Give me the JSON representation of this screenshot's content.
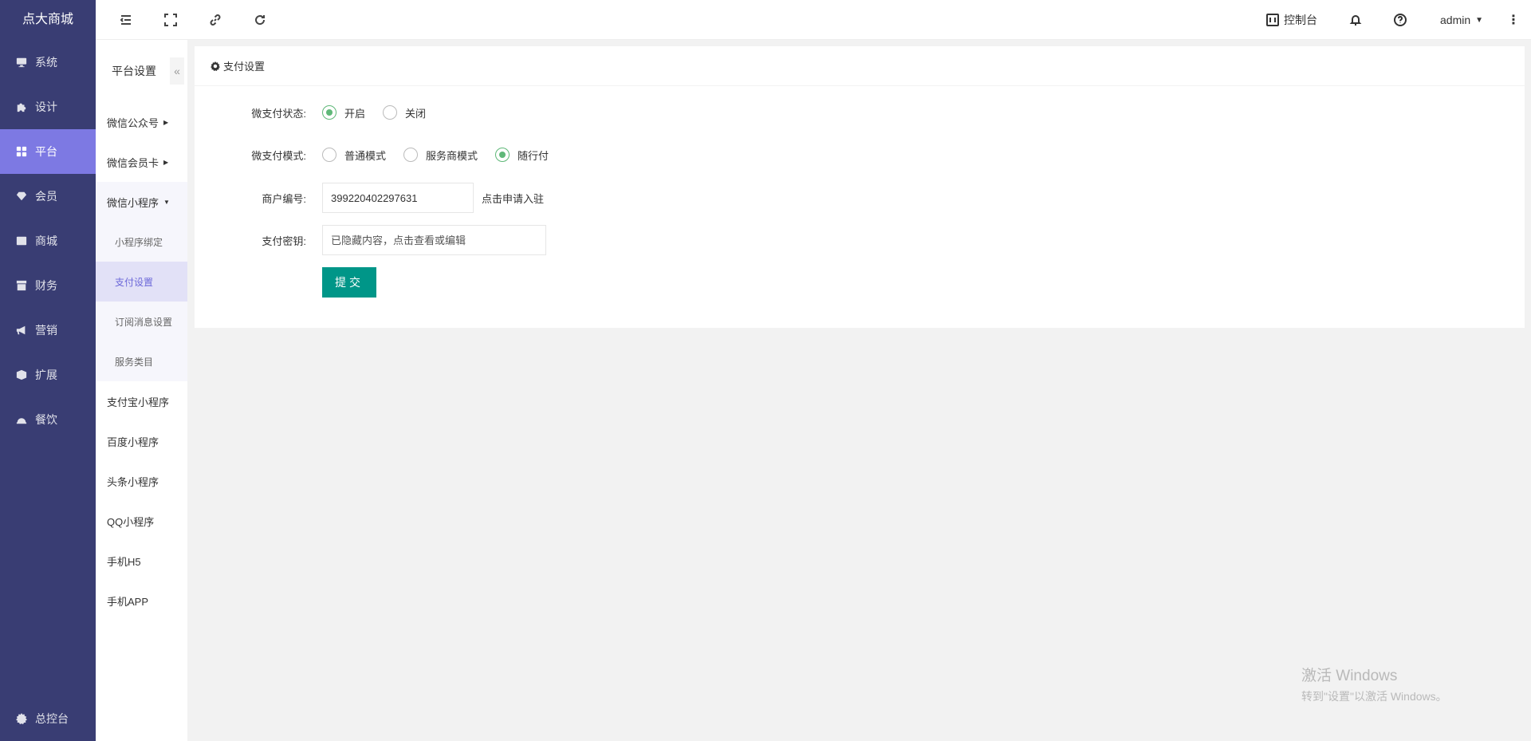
{
  "app": {
    "logo_text": "点大商城"
  },
  "sidebar": {
    "items": [
      {
        "label": "系统",
        "icon": "monitor-icon"
      },
      {
        "label": "设计",
        "icon": "puzzle-icon"
      },
      {
        "label": "平台",
        "icon": "grid-icon",
        "active": true
      },
      {
        "label": "会员",
        "icon": "diamond-icon"
      },
      {
        "label": "商城",
        "icon": "mail-icon"
      },
      {
        "label": "财务",
        "icon": "archive-icon"
      },
      {
        "label": "营销",
        "icon": "megaphone-icon"
      },
      {
        "label": "扩展",
        "icon": "cube-icon"
      },
      {
        "label": "餐饮",
        "icon": "cloche-icon"
      }
    ],
    "bottom_label": "总控台"
  },
  "header": {
    "console_label": "控制台",
    "user_label": "admin"
  },
  "subnav": {
    "title": "平台设置",
    "collapse_symbol": "«",
    "groups": [
      {
        "label": "微信公众号",
        "arrow": "▶"
      },
      {
        "label": "微信会员卡",
        "arrow": "▶"
      },
      {
        "label": "微信小程序",
        "arrow": "▼"
      }
    ],
    "children": [
      {
        "label": "小程序绑定"
      },
      {
        "label": "支付设置",
        "active": true
      },
      {
        "label": "订阅消息设置"
      },
      {
        "label": "服务类目"
      }
    ],
    "other_groups": [
      {
        "label": "支付宝小程序"
      },
      {
        "label": "百度小程序"
      },
      {
        "label": "头条小程序"
      },
      {
        "label": "QQ小程序"
      },
      {
        "label": "手机H5"
      },
      {
        "label": "手机APP"
      }
    ]
  },
  "card": {
    "title": "支付设置"
  },
  "form": {
    "status": {
      "label": "微支付状态:",
      "options": [
        "开启",
        "关闭"
      ],
      "selected": "开启"
    },
    "mode": {
      "label": "微支付模式:",
      "options": [
        "普通模式",
        "服务商模式",
        "随行付"
      ],
      "selected": "随行付"
    },
    "merchant": {
      "label": "商户编号:",
      "value": "399220402297631",
      "link": "点击申请入驻"
    },
    "secret": {
      "label": "支付密钥:",
      "placeholder": "已隐藏内容，点击查看或编辑"
    },
    "submit_label": "提交"
  },
  "watermark": {
    "line1": "激活 Windows",
    "line2": "转到\"设置\"以激活 Windows。"
  },
  "colors": {
    "sidebar_bg": "#393d73",
    "sidebar_active": "#7d79e3",
    "radio_checked": "#5fb878",
    "submit_bg": "#009688",
    "subnav_active_text": "#6c68d9"
  }
}
